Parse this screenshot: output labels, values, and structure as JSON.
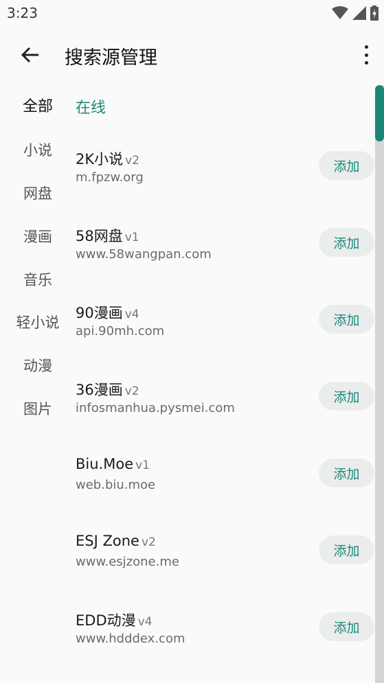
{
  "status": {
    "time": "3:23"
  },
  "appbar": {
    "title": "搜索源管理"
  },
  "categories": [
    "全部",
    "小说",
    "网盘",
    "漫画",
    "音乐",
    "轻小说",
    "动漫",
    "图片"
  ],
  "filter": {
    "label": "在线"
  },
  "sources": [
    {
      "name": "2K小说",
      "version": "v2",
      "url": "m.fpzw.org",
      "action": "添加"
    },
    {
      "name": "58网盘",
      "version": "v1",
      "url": "www.58wangpan.com",
      "action": "添加"
    },
    {
      "name": "90漫画",
      "version": "v4",
      "url": "api.90mh.com",
      "action": "添加"
    },
    {
      "name": "36漫画",
      "version": "v2",
      "url": "infosmanhua.pysmei.com",
      "action": "添加"
    },
    {
      "name": "Biu.Moe",
      "version": "v1",
      "url": "web.biu.moe",
      "action": "添加"
    },
    {
      "name": "ESJ Zone",
      "version": "v2",
      "url": "www.esjzone.me",
      "action": "添加"
    },
    {
      "name": "EDD动漫",
      "version": "v4",
      "url": "www.hdddex.com",
      "action": "添加"
    }
  ],
  "icons": {
    "status": [
      "wifi-icon",
      "signal-icon",
      "battery-charging-icon"
    ],
    "appbar": [
      "back-arrow-icon",
      "more-vert-icon"
    ]
  },
  "colors": {
    "accent": "#1a8a7a",
    "button_bg": "#ebeded",
    "scrollbar": "#1b8677"
  }
}
